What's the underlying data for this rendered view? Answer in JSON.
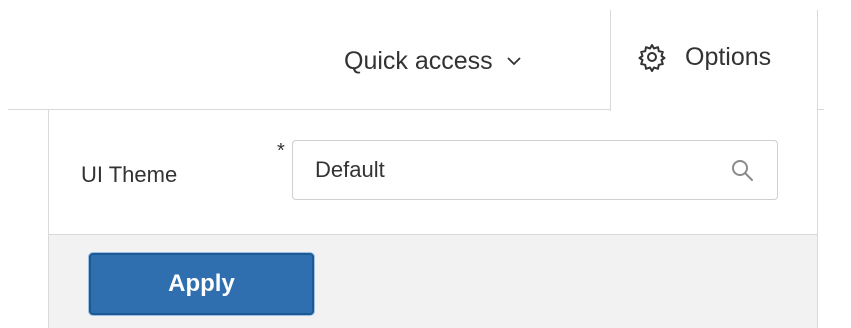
{
  "header": {
    "quick_access_label": "Quick access",
    "options_label": "Options"
  },
  "icons": {
    "quick_access_chevron": "chevron-down-icon",
    "options": "gear-icon",
    "theme_search": "search-icon"
  },
  "form": {
    "ui_theme": {
      "label": "UI Theme",
      "required_marker": "*",
      "value": "Default"
    }
  },
  "footer": {
    "apply_label": "Apply"
  },
  "colors": {
    "apply_button": "#2f6fb0",
    "footer_background": "#f2f2f2",
    "border": "#d9d9d9",
    "text": "#333333"
  }
}
